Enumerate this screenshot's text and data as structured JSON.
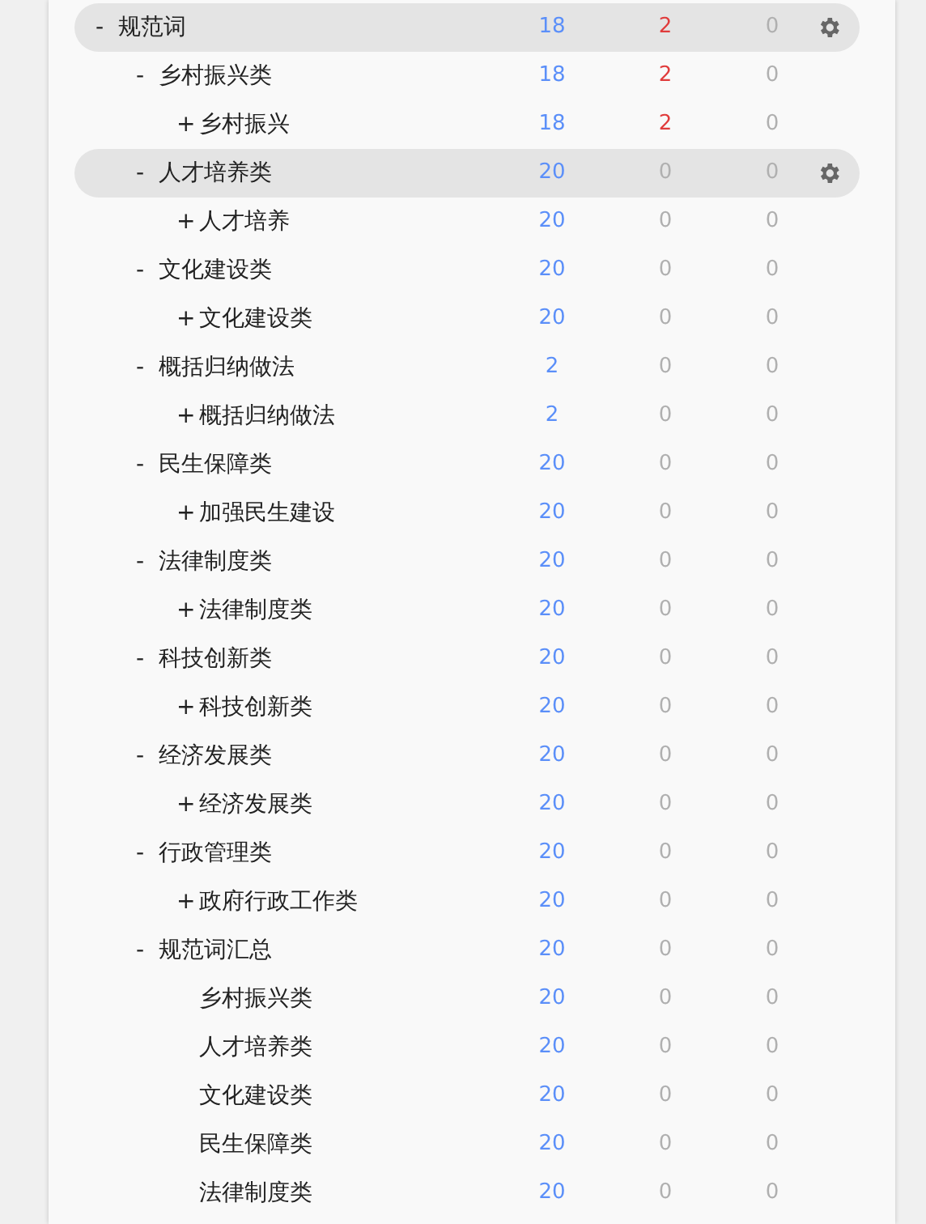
{
  "tree": [
    {
      "marker": "-",
      "label": "规范词",
      "counts": [
        "18",
        "2",
        "0"
      ],
      "alert": true,
      "highlighted": true,
      "children": [
        {
          "marker": "-",
          "label": "乡村振兴类",
          "counts": [
            "18",
            "2",
            "0"
          ],
          "alert": true,
          "highlighted": false,
          "children": [
            {
              "marker": "+",
              "label": "乡村振兴",
              "counts": [
                "18",
                "2",
                "0"
              ],
              "alert": true,
              "highlighted": false
            }
          ]
        },
        {
          "marker": "-",
          "label": "人才培养类",
          "counts": [
            "20",
            "0",
            "0"
          ],
          "alert": false,
          "highlighted": true,
          "children": [
            {
              "marker": "+",
              "label": "人才培养",
              "counts": [
                "20",
                "0",
                "0"
              ],
              "alert": false,
              "highlighted": false
            }
          ]
        },
        {
          "marker": "-",
          "label": "文化建设类",
          "counts": [
            "20",
            "0",
            "0"
          ],
          "alert": false,
          "highlighted": false,
          "children": [
            {
              "marker": "+",
              "label": "文化建设类",
              "counts": [
                "20",
                "0",
                "0"
              ],
              "alert": false,
              "highlighted": false
            }
          ]
        },
        {
          "marker": "-",
          "label": "概括归纳做法",
          "counts": [
            "2",
            "0",
            "0"
          ],
          "alert": false,
          "highlighted": false,
          "children": [
            {
              "marker": "+",
              "label": "概括归纳做法",
              "counts": [
                "2",
                "0",
                "0"
              ],
              "alert": false,
              "highlighted": false
            }
          ]
        },
        {
          "marker": "-",
          "label": "民生保障类",
          "counts": [
            "20",
            "0",
            "0"
          ],
          "alert": false,
          "highlighted": false,
          "children": [
            {
              "marker": "+",
              "label": "加强民生建设",
              "counts": [
                "20",
                "0",
                "0"
              ],
              "alert": false,
              "highlighted": false
            }
          ]
        },
        {
          "marker": "-",
          "label": "法律制度类",
          "counts": [
            "20",
            "0",
            "0"
          ],
          "alert": false,
          "highlighted": false,
          "children": [
            {
              "marker": "+",
              "label": "法律制度类",
              "counts": [
                "20",
                "0",
                "0"
              ],
              "alert": false,
              "highlighted": false
            }
          ]
        },
        {
          "marker": "-",
          "label": "科技创新类",
          "counts": [
            "20",
            "0",
            "0"
          ],
          "alert": false,
          "highlighted": false,
          "children": [
            {
              "marker": "+",
              "label": "科技创新类",
              "counts": [
                "20",
                "0",
                "0"
              ],
              "alert": false,
              "highlighted": false
            }
          ]
        },
        {
          "marker": "-",
          "label": "经济发展类",
          "counts": [
            "20",
            "0",
            "0"
          ],
          "alert": false,
          "highlighted": false,
          "children": [
            {
              "marker": "+",
              "label": "经济发展类",
              "counts": [
                "20",
                "0",
                "0"
              ],
              "alert": false,
              "highlighted": false
            }
          ]
        },
        {
          "marker": "-",
          "label": "行政管理类",
          "counts": [
            "20",
            "0",
            "0"
          ],
          "alert": false,
          "highlighted": false,
          "children": [
            {
              "marker": "+",
              "label": "政府行政工作类",
              "counts": [
                "20",
                "0",
                "0"
              ],
              "alert": false,
              "highlighted": false
            }
          ]
        },
        {
          "marker": "-",
          "label": "规范词汇总",
          "counts": [
            "20",
            "0",
            "0"
          ],
          "alert": false,
          "highlighted": false,
          "children": [
            {
              "label": "乡村振兴类",
              "counts": [
                "20",
                "0",
                "0"
              ],
              "alert": false,
              "highlighted": false
            },
            {
              "label": "人才培养类",
              "counts": [
                "20",
                "0",
                "0"
              ],
              "alert": false,
              "highlighted": false
            },
            {
              "label": "文化建设类",
              "counts": [
                "20",
                "0",
                "0"
              ],
              "alert": false,
              "highlighted": false
            },
            {
              "label": "民生保障类",
              "counts": [
                "20",
                "0",
                "0"
              ],
              "alert": false,
              "highlighted": false
            },
            {
              "label": "法律制度类",
              "counts": [
                "20",
                "0",
                "0"
              ],
              "alert": false,
              "highlighted": false
            }
          ]
        }
      ]
    }
  ]
}
